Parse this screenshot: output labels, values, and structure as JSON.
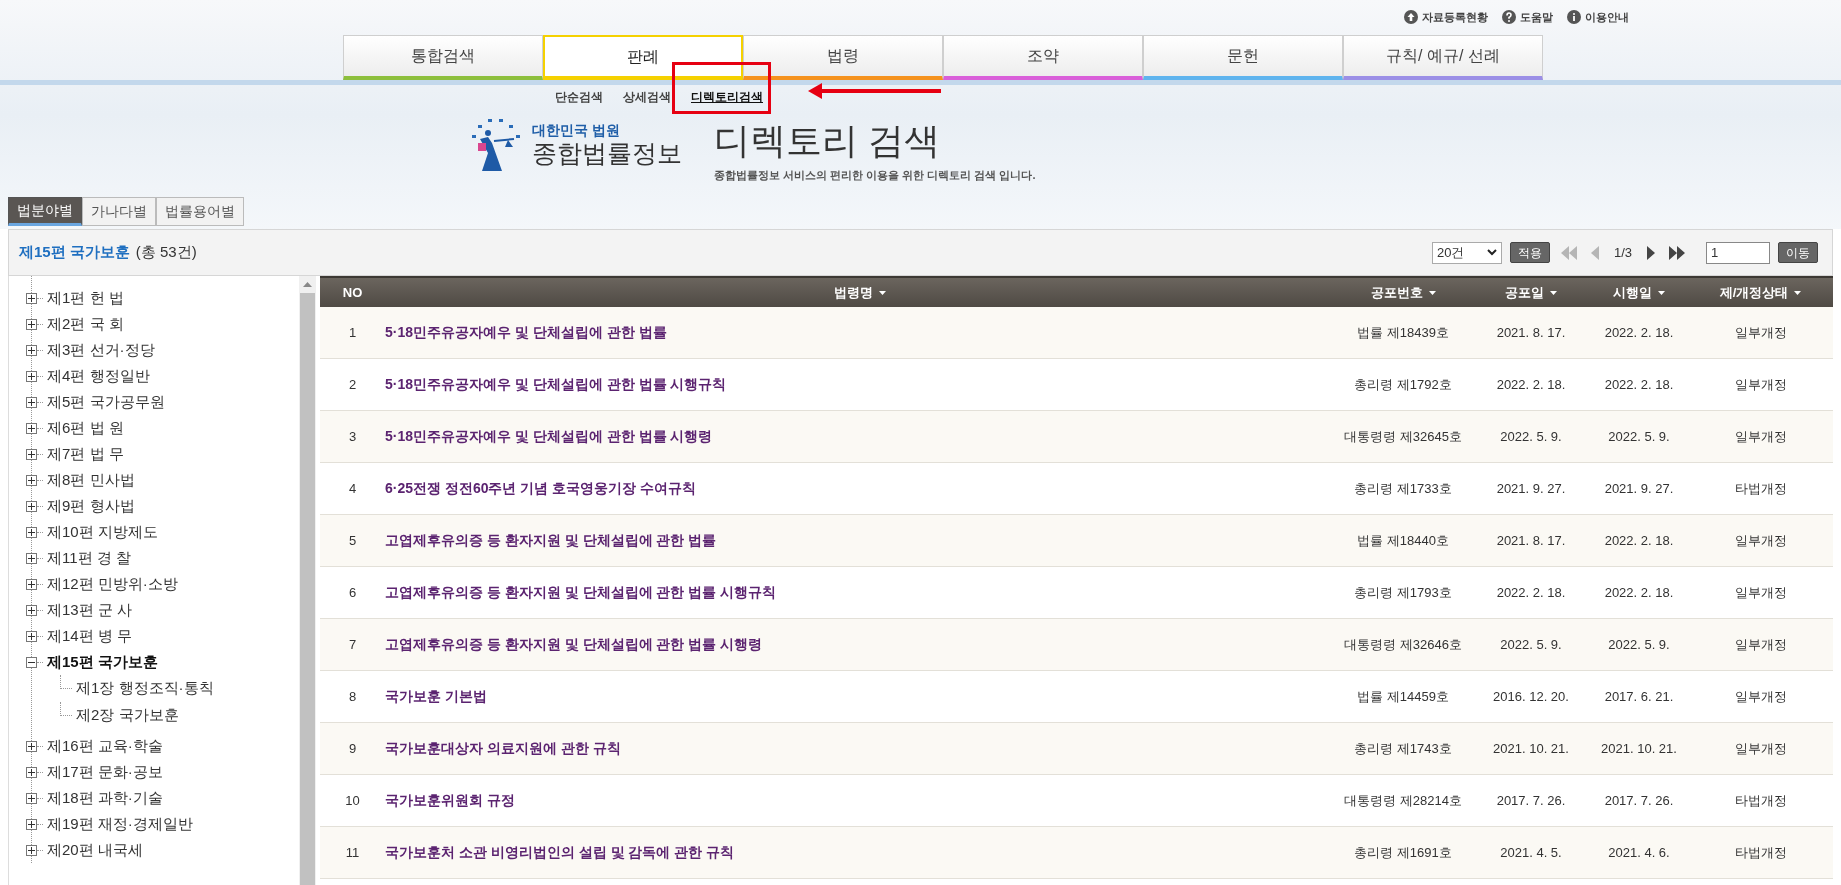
{
  "top_links": [
    {
      "label": "자료등록현황",
      "kind": "upload"
    },
    {
      "label": "도움말",
      "kind": "help"
    },
    {
      "label": "이용안내",
      "kind": "info"
    }
  ],
  "nav_tabs": [
    {
      "label": "통합검색",
      "selected": false,
      "color": "#8dbf3c"
    },
    {
      "label": "판례",
      "selected": true,
      "color": "#f5d100"
    },
    {
      "label": "법령",
      "selected": false,
      "color": "#f5921e"
    },
    {
      "label": "조약",
      "selected": false,
      "color": "#d95fd9"
    },
    {
      "label": "문헌",
      "selected": false,
      "color": "#5fb4ee"
    },
    {
      "label": "규칙/ 예규/ 선례",
      "selected": false,
      "color": "#9b8fe6"
    }
  ],
  "sub_tabs": [
    {
      "label": "단순검색",
      "selected": false
    },
    {
      "label": "상세검색",
      "selected": false
    },
    {
      "label": "디렉토리검색",
      "selected": true
    }
  ],
  "logo": {
    "org": "대한민국 법원",
    "name": "종합법률정보"
  },
  "page_title": "디렉토리 검색",
  "page_subtitle": "종합법률정보 서비스의 편리한 이용을 위한 디렉토리 검색 입니다.",
  "view_tabs": [
    {
      "label": "법분야별",
      "selected": true
    },
    {
      "label": "가나다별",
      "selected": false
    },
    {
      "label": "법률용어별",
      "selected": false
    }
  ],
  "panel": {
    "title": "제15편 국가보훈",
    "count": "(총 53건)"
  },
  "page_size": "20건",
  "apply_button": "적용",
  "pager": {
    "position": "1/3",
    "back_disabled": true,
    "forward_disabled": false
  },
  "page_input": "1",
  "go_button": "이동",
  "tree": [
    {
      "label": "제1편 헌 법",
      "expanded": false,
      "selected": false
    },
    {
      "label": "제2편 국 회",
      "expanded": false,
      "selected": false
    },
    {
      "label": "제3편 선거·정당",
      "expanded": false,
      "selected": false
    },
    {
      "label": "제4편 행정일반",
      "expanded": false,
      "selected": false
    },
    {
      "label": "제5편 국가공무원",
      "expanded": false,
      "selected": false
    },
    {
      "label": "제6편 법 원",
      "expanded": false,
      "selected": false
    },
    {
      "label": "제7편 법 무",
      "expanded": false,
      "selected": false
    },
    {
      "label": "제8편 민사법",
      "expanded": false,
      "selected": false
    },
    {
      "label": "제9편 형사법",
      "expanded": false,
      "selected": false
    },
    {
      "label": "제10편 지방제도",
      "expanded": false,
      "selected": false
    },
    {
      "label": "제11편 경 찰",
      "expanded": false,
      "selected": false
    },
    {
      "label": "제12편 민방위·소방",
      "expanded": false,
      "selected": false
    },
    {
      "label": "제13편 군 사",
      "expanded": false,
      "selected": false
    },
    {
      "label": "제14편 병 무",
      "expanded": false,
      "selected": false
    },
    {
      "label": "제15편 국가보훈",
      "expanded": true,
      "selected": true,
      "children": [
        {
          "label": "제1장 행정조직·통칙",
          "selected": false
        },
        {
          "label": "제2장 국가보훈",
          "selected": false
        }
      ]
    },
    {
      "label": "제16편 교육·학술",
      "expanded": false,
      "selected": false
    },
    {
      "label": "제17편 문화·공보",
      "expanded": false,
      "selected": false
    },
    {
      "label": "제18편 과학·기술",
      "expanded": false,
      "selected": false
    },
    {
      "label": "제19편 재정·경제일반",
      "expanded": false,
      "selected": false
    },
    {
      "label": "제20편 내국세",
      "expanded": false,
      "selected": false
    }
  ],
  "table": {
    "columns": [
      "NO",
      "법령명",
      "공포번호",
      "공포일",
      "시행일",
      "제/개정상태"
    ],
    "rows": [
      {
        "no": "1",
        "name": "5·18민주유공자예우 및 단체설립에 관한 법률",
        "number": "법률 제18439호",
        "promulgated": "2021. 8. 17.",
        "effective": "2022. 2. 18.",
        "status": "일부개정"
      },
      {
        "no": "2",
        "name": "5·18민주유공자예우 및 단체설립에 관한 법률 시행규칙",
        "number": "총리령 제1792호",
        "promulgated": "2022. 2. 18.",
        "effective": "2022. 2. 18.",
        "status": "일부개정"
      },
      {
        "no": "3",
        "name": "5·18민주유공자예우 및 단체설립에 관한 법률 시행령",
        "number": "대통령령 제32645호",
        "promulgated": "2022. 5. 9.",
        "effective": "2022. 5. 9.",
        "status": "일부개정"
      },
      {
        "no": "4",
        "name": "6·25전쟁 정전60주년 기념 호국영웅기장 수여규칙",
        "number": "총리령 제1733호",
        "promulgated": "2021. 9. 27.",
        "effective": "2021. 9. 27.",
        "status": "타법개정"
      },
      {
        "no": "5",
        "name": "고엽제후유의증 등 환자지원 및 단체설립에 관한 법률",
        "number": "법률 제18440호",
        "promulgated": "2021. 8. 17.",
        "effective": "2022. 2. 18.",
        "status": "일부개정"
      },
      {
        "no": "6",
        "name": "고엽제후유의증 등 환자지원 및 단체설립에 관한 법률 시행규칙",
        "number": "총리령 제1793호",
        "promulgated": "2022. 2. 18.",
        "effective": "2022. 2. 18.",
        "status": "일부개정"
      },
      {
        "no": "7",
        "name": "고엽제후유의증 등 환자지원 및 단체설립에 관한 법률 시행령",
        "number": "대통령령 제32646호",
        "promulgated": "2022. 5. 9.",
        "effective": "2022. 5. 9.",
        "status": "일부개정"
      },
      {
        "no": "8",
        "name": "국가보훈 기본법",
        "number": "법률 제14459호",
        "promulgated": "2016. 12. 20.",
        "effective": "2017. 6. 21.",
        "status": "일부개정"
      },
      {
        "no": "9",
        "name": "국가보훈대상자 의료지원에 관한 규칙",
        "number": "총리령 제1743호",
        "promulgated": "2021. 10. 21.",
        "effective": "2021. 10. 21.",
        "status": "일부개정"
      },
      {
        "no": "10",
        "name": "국가보훈위원회 규정",
        "number": "대통령령 제28214호",
        "promulgated": "2017. 7. 26.",
        "effective": "2017. 7. 26.",
        "status": "타법개정"
      },
      {
        "no": "11",
        "name": "국가보훈처 소관 비영리법인의 설립 및 감독에 관한 규칙",
        "number": "총리령 제1691호",
        "promulgated": "2021. 4. 5.",
        "effective": "2021. 4. 6.",
        "status": "타법개정"
      }
    ]
  }
}
